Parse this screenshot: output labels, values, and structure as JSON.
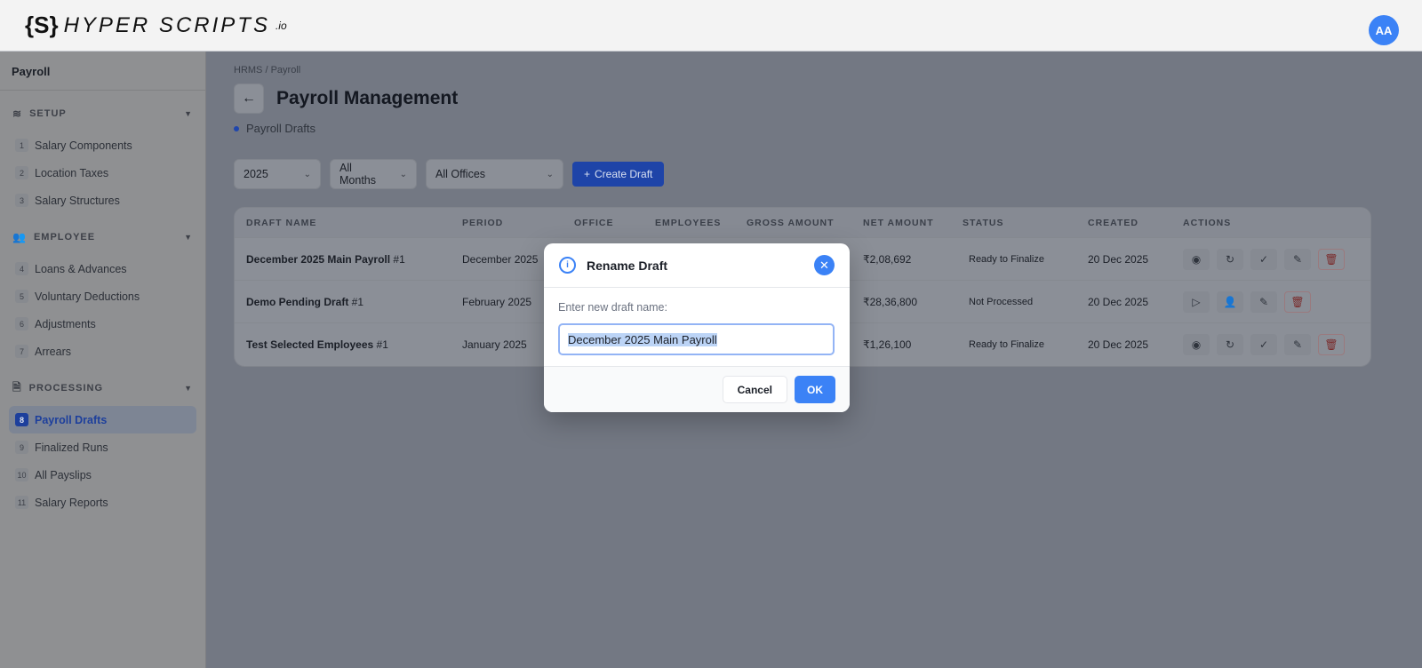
{
  "header": {
    "logo_text": "HYPER SCRIPTS.io",
    "logo_main": "HYPER SCRIPTS",
    "logo_suffix": ".io",
    "avatar": "AA"
  },
  "sidebar": {
    "title": "Payroll",
    "sections": [
      {
        "label": "SETUP",
        "icon": "layers-icon",
        "items": [
          {
            "num": "1",
            "label": "Salary Components"
          },
          {
            "num": "2",
            "label": "Location Taxes"
          },
          {
            "num": "3",
            "label": "Salary Structures"
          }
        ]
      },
      {
        "label": "EMPLOYEE",
        "icon": "users-icon",
        "items": [
          {
            "num": "4",
            "label": "Loans & Advances"
          },
          {
            "num": "5",
            "label": "Voluntary Deductions"
          },
          {
            "num": "6",
            "label": "Adjustments"
          },
          {
            "num": "7",
            "label": "Arrears"
          }
        ]
      },
      {
        "label": "PROCESSING",
        "icon": "document-icon",
        "items": [
          {
            "num": "8",
            "label": "Payroll Drafts",
            "active": true
          },
          {
            "num": "9",
            "label": "Finalized Runs"
          },
          {
            "num": "10",
            "label": "All Payslips"
          },
          {
            "num": "11",
            "label": "Salary Reports"
          }
        ]
      }
    ]
  },
  "breadcrumb": [
    "HRMS",
    "/",
    "Payroll"
  ],
  "page": {
    "title": "Payroll Management",
    "subtitle": "Payroll Drafts"
  },
  "filters": {
    "year": "2025",
    "month": "All Months",
    "office": "All Offices",
    "create": "Create Draft"
  },
  "table": {
    "headers": [
      "DRAFT NAME",
      "PERIOD",
      "OFFICE",
      "EMPLOYEES",
      "GROSS AMOUNT",
      "NET AMOUNT",
      "STATUS",
      "CREATED",
      "ACTIONS"
    ],
    "rows": [
      {
        "name": "December 2025 Main Payroll",
        "suffix": " #1",
        "period": "December 2025",
        "net": "₹2,08,692",
        "status": "Ready to Finalize",
        "created": "20 Dec 2025",
        "actions": [
          "view",
          "recalculate",
          "finalize",
          "edit",
          "delete"
        ]
      },
      {
        "name": "Demo Pending Draft",
        "suffix": " #1",
        "period": "February 2025",
        "net": "₹28,36,800",
        "status": "Not Processed",
        "created": "20 Dec 2025",
        "actions": [
          "process",
          "select-employees",
          "edit",
          "delete"
        ]
      },
      {
        "name": "Test Selected Employees",
        "suffix": " #1",
        "period": "January 2025",
        "net": "₹1,26,100",
        "status": "Ready to Finalize",
        "created": "20 Dec 2025",
        "actions": [
          "view",
          "recalculate",
          "finalize",
          "edit",
          "delete"
        ]
      }
    ]
  },
  "modal": {
    "title": "Rename Draft",
    "label": "Enter new draft name:",
    "value": "December 2025 Main Payroll",
    "cancel": "Cancel",
    "ok": "OK"
  }
}
